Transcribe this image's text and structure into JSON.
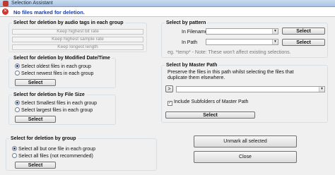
{
  "window": {
    "title": "Selection Assistant"
  },
  "banner": {
    "text": "No files marked for deletion."
  },
  "audio_tags": {
    "title": "Select for deletion by audio tags in each group",
    "options": [
      "Keep highest bit rate",
      "Keep highest sample rate",
      "Keep longest length"
    ]
  },
  "modified_date": {
    "title": "Select for deletion by Modified Date/Time",
    "options": [
      "Select oldest files in each group",
      "Select newest files in each group"
    ],
    "selected_index": 0,
    "button": "Select"
  },
  "file_size": {
    "title": "Select for deletion by File Size",
    "options": [
      "Select Smallest files in each group",
      "Select largest files in each group"
    ],
    "selected_index": 0,
    "button": "Select"
  },
  "by_group": {
    "title": "Select for deletion by group",
    "options": [
      "Select all but one file in each group",
      "Select all files (not recommended)"
    ],
    "selected_index": 0,
    "button": "Select"
  },
  "by_pattern": {
    "title": "Select by pattern",
    "in_filename_label": "In Filename",
    "in_filename_value": "",
    "in_filename_button": "Select",
    "in_path_label": "In Path",
    "in_path_value": "",
    "in_path_button": "Select",
    "note": "eg. *temp* - Note: These won't affect existing selections."
  },
  "master_path": {
    "title": "Select by Master Path",
    "description": "Preserve the files in this path whilst selecting the files that duplicate them elsewhere.",
    "browse_label": ">",
    "path_value": "",
    "include_subfolders_label": "Include Subfolders of Master Path",
    "include_subfolders_checked": true,
    "button": "Select"
  },
  "actions": {
    "unmark_all": "Unmark all selected",
    "close": "Close"
  }
}
